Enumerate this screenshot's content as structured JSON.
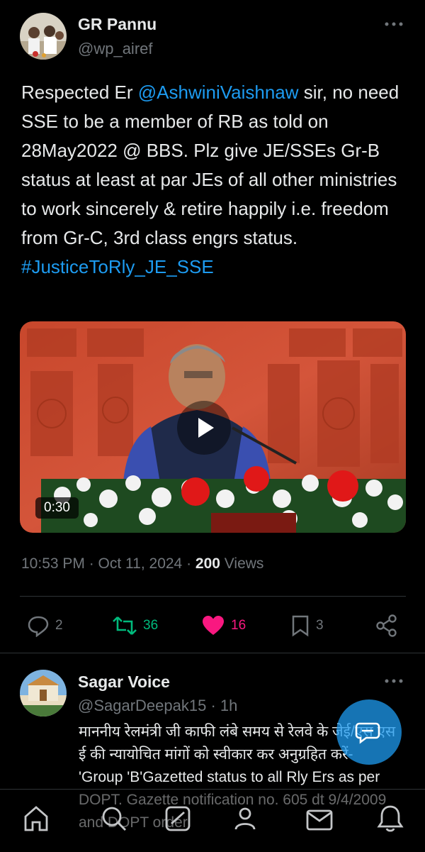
{
  "tweet": {
    "author_name": "GR Pannu",
    "author_handle": "@wp_airef",
    "text_parts": {
      "intro": "Respected Er ",
      "mention": "@AshwiniVaishnaw",
      "body": " sir, no need SSE to be a member of RB as told on 28May2022 @ BBS. Plz give JE/SSEs Gr-B status at least at par JEs of all other ministries to work sincerely & retire happily i.e. freedom from Gr-C, 3rd class engrs status.",
      "hashtag": "#JusticeToRly_JE_SSE"
    },
    "video_duration": "0:30",
    "timestamp": "10:53 PM · Oct 11, 2024 · ",
    "views_count": "200",
    "views_label": " Views",
    "replies": "2",
    "retweets": "36",
    "likes": "16",
    "bookmarks": "3"
  },
  "reply": {
    "author_name": "Sagar Voice",
    "author_handle": "@SagarDeepak15 · 1h",
    "text_line1": "माननीय रेलमंत्री जी काफी लंबे समय से रेलवे के जेई/एस एस ई की न्यायोचित मांगों को स्वीकार कर अनुग्रहित करें-",
    "text_line2": "'Group 'B'Gazetted status to all Rly Ers as per DOPT. Gazette notification no. 605 dt 9/4/2009 and DOPT order"
  },
  "colors": {
    "accent": "#1d9bf0",
    "retweet": "#00ba7c",
    "like": "#f91880",
    "muted": "#71767b"
  },
  "icons": [
    "more-icon",
    "play-icon",
    "reply-icon",
    "retweet-icon",
    "like-icon",
    "bookmark-icon",
    "share-icon",
    "compose-icon",
    "home-icon",
    "search-icon",
    "grok-icon",
    "communities-icon",
    "notifications-icon",
    "messages-icon"
  ]
}
